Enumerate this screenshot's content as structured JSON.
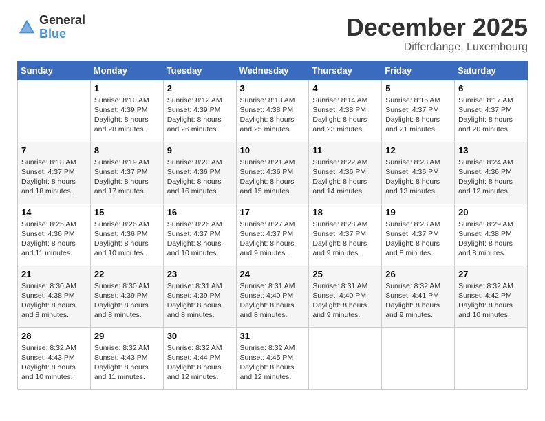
{
  "header": {
    "logo_general": "General",
    "logo_blue": "Blue",
    "month_title": "December 2025",
    "location": "Differdange, Luxembourg"
  },
  "days_of_week": [
    "Sunday",
    "Monday",
    "Tuesday",
    "Wednesday",
    "Thursday",
    "Friday",
    "Saturday"
  ],
  "weeks": [
    [
      {
        "day": "",
        "sunrise": "",
        "sunset": "",
        "daylight": ""
      },
      {
        "day": "1",
        "sunrise": "Sunrise: 8:10 AM",
        "sunset": "Sunset: 4:39 PM",
        "daylight": "Daylight: 8 hours and 28 minutes."
      },
      {
        "day": "2",
        "sunrise": "Sunrise: 8:12 AM",
        "sunset": "Sunset: 4:39 PM",
        "daylight": "Daylight: 8 hours and 26 minutes."
      },
      {
        "day": "3",
        "sunrise": "Sunrise: 8:13 AM",
        "sunset": "Sunset: 4:38 PM",
        "daylight": "Daylight: 8 hours and 25 minutes."
      },
      {
        "day": "4",
        "sunrise": "Sunrise: 8:14 AM",
        "sunset": "Sunset: 4:38 PM",
        "daylight": "Daylight: 8 hours and 23 minutes."
      },
      {
        "day": "5",
        "sunrise": "Sunrise: 8:15 AM",
        "sunset": "Sunset: 4:37 PM",
        "daylight": "Daylight: 8 hours and 21 minutes."
      },
      {
        "day": "6",
        "sunrise": "Sunrise: 8:17 AM",
        "sunset": "Sunset: 4:37 PM",
        "daylight": "Daylight: 8 hours and 20 minutes."
      }
    ],
    [
      {
        "day": "7",
        "sunrise": "Sunrise: 8:18 AM",
        "sunset": "Sunset: 4:37 PM",
        "daylight": "Daylight: 8 hours and 18 minutes."
      },
      {
        "day": "8",
        "sunrise": "Sunrise: 8:19 AM",
        "sunset": "Sunset: 4:37 PM",
        "daylight": "Daylight: 8 hours and 17 minutes."
      },
      {
        "day": "9",
        "sunrise": "Sunrise: 8:20 AM",
        "sunset": "Sunset: 4:36 PM",
        "daylight": "Daylight: 8 hours and 16 minutes."
      },
      {
        "day": "10",
        "sunrise": "Sunrise: 8:21 AM",
        "sunset": "Sunset: 4:36 PM",
        "daylight": "Daylight: 8 hours and 15 minutes."
      },
      {
        "day": "11",
        "sunrise": "Sunrise: 8:22 AM",
        "sunset": "Sunset: 4:36 PM",
        "daylight": "Daylight: 8 hours and 14 minutes."
      },
      {
        "day": "12",
        "sunrise": "Sunrise: 8:23 AM",
        "sunset": "Sunset: 4:36 PM",
        "daylight": "Daylight: 8 hours and 13 minutes."
      },
      {
        "day": "13",
        "sunrise": "Sunrise: 8:24 AM",
        "sunset": "Sunset: 4:36 PM",
        "daylight": "Daylight: 8 hours and 12 minutes."
      }
    ],
    [
      {
        "day": "14",
        "sunrise": "Sunrise: 8:25 AM",
        "sunset": "Sunset: 4:36 PM",
        "daylight": "Daylight: 8 hours and 11 minutes."
      },
      {
        "day": "15",
        "sunrise": "Sunrise: 8:26 AM",
        "sunset": "Sunset: 4:36 PM",
        "daylight": "Daylight: 8 hours and 10 minutes."
      },
      {
        "day": "16",
        "sunrise": "Sunrise: 8:26 AM",
        "sunset": "Sunset: 4:37 PM",
        "daylight": "Daylight: 8 hours and 10 minutes."
      },
      {
        "day": "17",
        "sunrise": "Sunrise: 8:27 AM",
        "sunset": "Sunset: 4:37 PM",
        "daylight": "Daylight: 8 hours and 9 minutes."
      },
      {
        "day": "18",
        "sunrise": "Sunrise: 8:28 AM",
        "sunset": "Sunset: 4:37 PM",
        "daylight": "Daylight: 8 hours and 9 minutes."
      },
      {
        "day": "19",
        "sunrise": "Sunrise: 8:28 AM",
        "sunset": "Sunset: 4:37 PM",
        "daylight": "Daylight: 8 hours and 8 minutes."
      },
      {
        "day": "20",
        "sunrise": "Sunrise: 8:29 AM",
        "sunset": "Sunset: 4:38 PM",
        "daylight": "Daylight: 8 hours and 8 minutes."
      }
    ],
    [
      {
        "day": "21",
        "sunrise": "Sunrise: 8:30 AM",
        "sunset": "Sunset: 4:38 PM",
        "daylight": "Daylight: 8 hours and 8 minutes."
      },
      {
        "day": "22",
        "sunrise": "Sunrise: 8:30 AM",
        "sunset": "Sunset: 4:39 PM",
        "daylight": "Daylight: 8 hours and 8 minutes."
      },
      {
        "day": "23",
        "sunrise": "Sunrise: 8:31 AM",
        "sunset": "Sunset: 4:39 PM",
        "daylight": "Daylight: 8 hours and 8 minutes."
      },
      {
        "day": "24",
        "sunrise": "Sunrise: 8:31 AM",
        "sunset": "Sunset: 4:40 PM",
        "daylight": "Daylight: 8 hours and 8 minutes."
      },
      {
        "day": "25",
        "sunrise": "Sunrise: 8:31 AM",
        "sunset": "Sunset: 4:40 PM",
        "daylight": "Daylight: 8 hours and 9 minutes."
      },
      {
        "day": "26",
        "sunrise": "Sunrise: 8:32 AM",
        "sunset": "Sunset: 4:41 PM",
        "daylight": "Daylight: 8 hours and 9 minutes."
      },
      {
        "day": "27",
        "sunrise": "Sunrise: 8:32 AM",
        "sunset": "Sunset: 4:42 PM",
        "daylight": "Daylight: 8 hours and 10 minutes."
      }
    ],
    [
      {
        "day": "28",
        "sunrise": "Sunrise: 8:32 AM",
        "sunset": "Sunset: 4:43 PM",
        "daylight": "Daylight: 8 hours and 10 minutes."
      },
      {
        "day": "29",
        "sunrise": "Sunrise: 8:32 AM",
        "sunset": "Sunset: 4:43 PM",
        "daylight": "Daylight: 8 hours and 11 minutes."
      },
      {
        "day": "30",
        "sunrise": "Sunrise: 8:32 AM",
        "sunset": "Sunset: 4:44 PM",
        "daylight": "Daylight: 8 hours and 12 minutes."
      },
      {
        "day": "31",
        "sunrise": "Sunrise: 8:32 AM",
        "sunset": "Sunset: 4:45 PM",
        "daylight": "Daylight: 8 hours and 12 minutes."
      },
      {
        "day": "",
        "sunrise": "",
        "sunset": "",
        "daylight": ""
      },
      {
        "day": "",
        "sunrise": "",
        "sunset": "",
        "daylight": ""
      },
      {
        "day": "",
        "sunrise": "",
        "sunset": "",
        "daylight": ""
      }
    ]
  ]
}
